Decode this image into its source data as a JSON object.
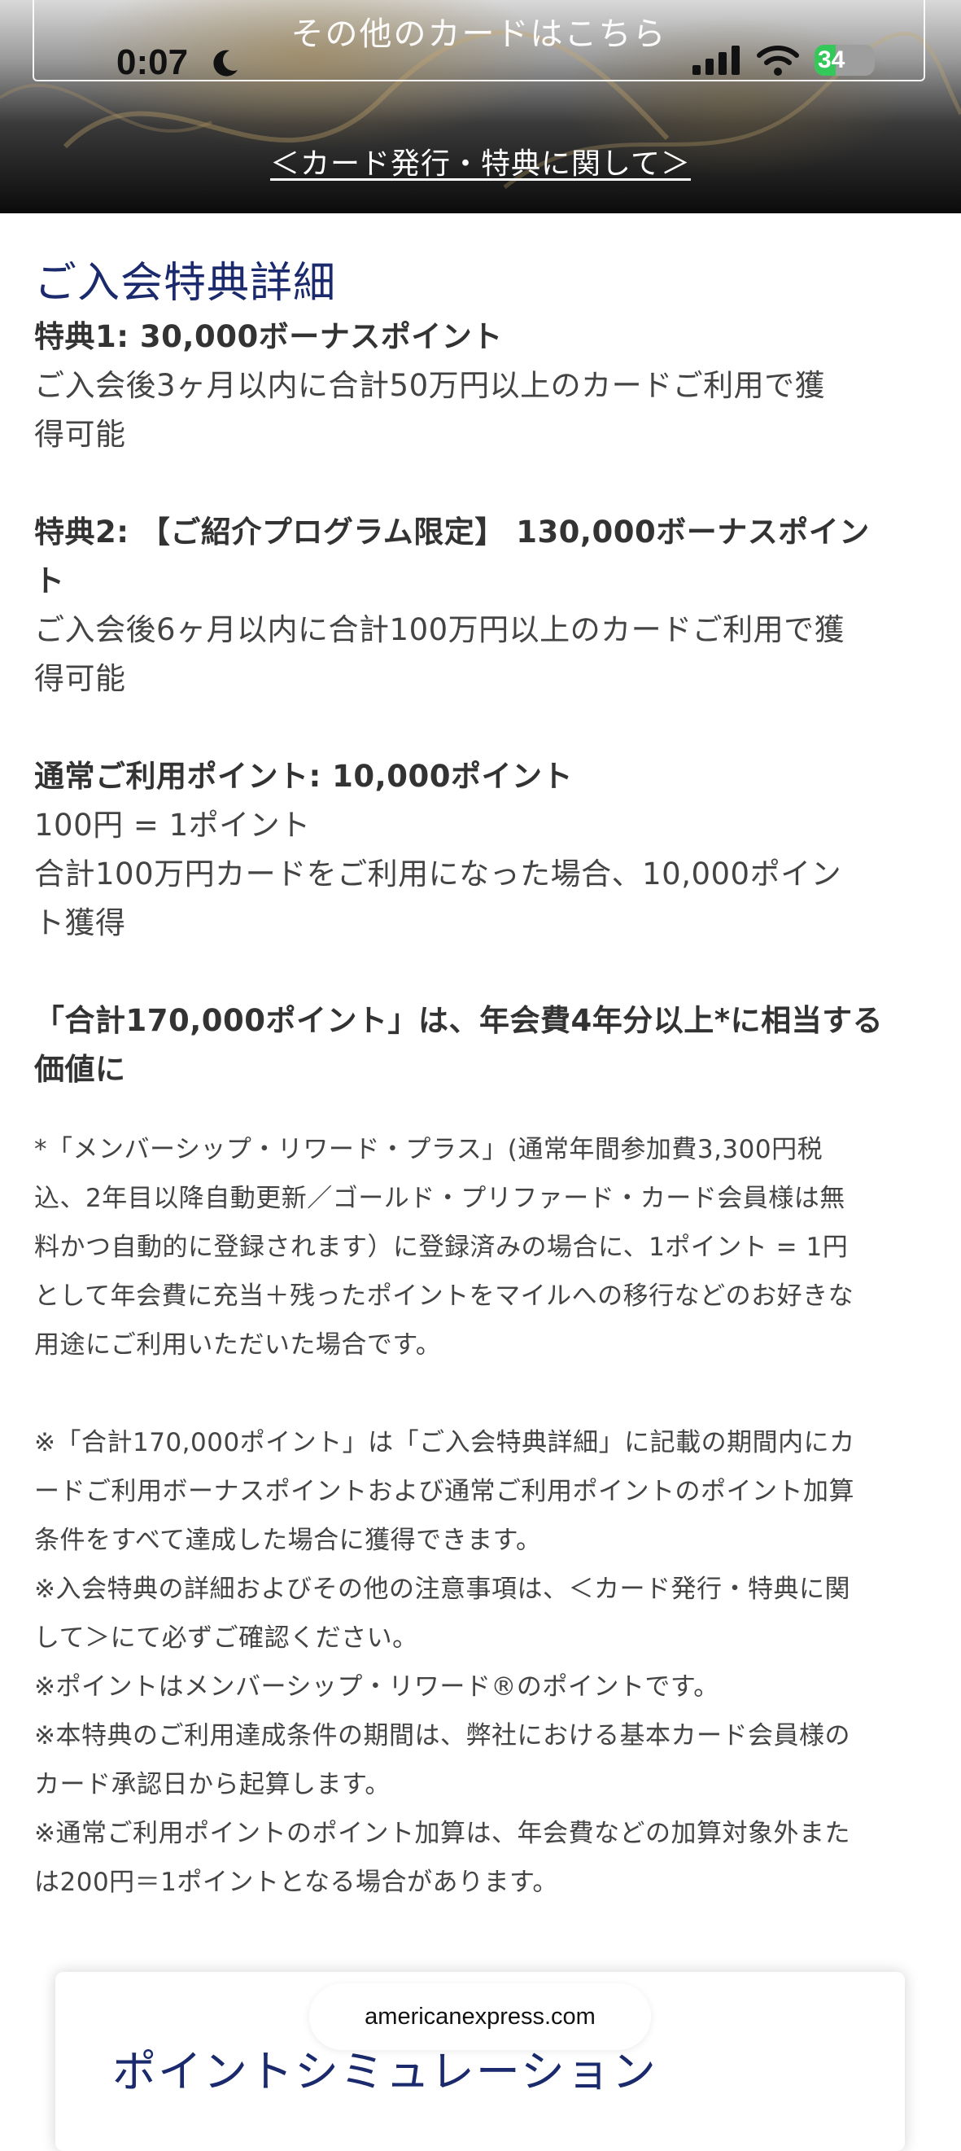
{
  "status_bar": {
    "time": "0:07",
    "battery": "34"
  },
  "hero": {
    "other_cards_button": "その他のカードはこちら",
    "issue_link": "＜カード発行・特典に関して＞"
  },
  "details": {
    "title": "ご入会特典詳細",
    "benefit1_heading": "特典1: 30,000ボーナスポイント",
    "benefit1_line1": "ご入会後3ヶ月以内に合計50万円以上のカードご利用で獲",
    "benefit1_line2": "得可能",
    "benefit2_heading_line1": "特典2: 【ご紹介プログラム限定】 130,000ボーナスポイン",
    "benefit2_heading_line2": "ト",
    "benefit2_line1": "ご入会後6ヶ月以内に合計100万円以上のカードご利用で獲",
    "benefit2_line2": "得可能",
    "normal_heading": "通常ご利用ポイント: 10,000ポイント",
    "normal_rate": "100円 = 1ポイント",
    "normal_line1": "合計100万円カードをご利用になった場合、10,000ポイン",
    "normal_line2": "ト獲得",
    "total_heading_line1": "「合計170,000ポイント」は、年会費4年分以上*に相当する",
    "total_heading_line2": "価値に"
  },
  "notes": {
    "asterisk_line1": "*「メンバーシップ・リワード・プラス」(通常年間参加費3,300円税",
    "asterisk_line2": "込、2年目以降自動更新／ゴールド・プリファード・カード会員様は無",
    "asterisk_line3": "料かつ自動的に登録されます）に登録済みの場合に、1ポイント = 1円",
    "asterisk_line4": "として年会費に充当＋残ったポイントをマイルへの移行などのお好きな",
    "asterisk_line5": "用途にご利用いただいた場合です。",
    "note1_line1": "※「合計170,000ポイント」は「ご入会特典詳細」に記載の期間内にカ",
    "note1_line2": "ードご利用ボーナスポイントおよび通常ご利用ポイントのポイント加算",
    "note1_line3": "条件をすべて達成した場合に獲得できます。",
    "note2_line1": "※入会特典の詳細およびその他の注意事項は、＜カード発行・特典に関",
    "note2_line2": "して＞にて必ずご確認ください。",
    "note3": "※ポイントはメンバーシップ・リワード®のポイントです。",
    "note4_line1": "※本特典のご利用達成条件の期間は、弊社における基本カード会員様の",
    "note4_line2": "カード承認日から起算します。",
    "note5_line1": "※通常ご利用ポイントのポイント加算は、年会費などの加算対象外また",
    "note5_line2": "は200円＝1ポイントとなる場合があります。"
  },
  "simulation": {
    "title": "ポイントシミュレーション"
  },
  "browser": {
    "url": "americanexpress.com"
  }
}
